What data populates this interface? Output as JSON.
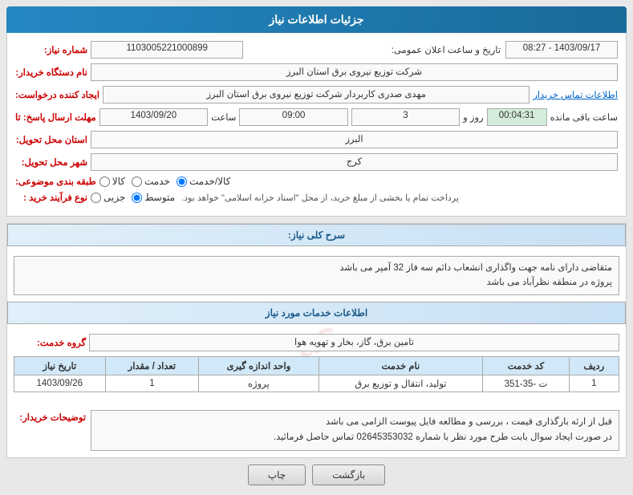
{
  "header": {
    "title": "جزئیات اطلاعات نیاز"
  },
  "form": {
    "need_number_label": "شماره نیاز:",
    "need_number_value": "1103005221000899",
    "buyer_org_label": "نام دستگاه خریدار:",
    "buyer_org_value": "شرکت توزیع نیروی برق استان البرز",
    "requester_label": "ایجاد کننده درخواست:",
    "requester_value": "مهدی صدری کاربردار شرکت توزیع نیروی برق استان البرز",
    "requester_contact_link": "اطلاعات تماس خریدار",
    "response_deadline_label": "مهلت ارسال پاسخ: تا",
    "response_deadline_date": "1403/09/20",
    "response_deadline_time": "09:00",
    "response_deadline_days": "3",
    "response_deadline_days_label": "روز و",
    "response_deadline_remaining": "00:04:31",
    "response_deadline_remaining_label": "ساعت باقی مانده",
    "delivery_province_label": "استان محل تحویل:",
    "delivery_province_value": "البرز",
    "delivery_city_label": "شهر محل تحویل:",
    "delivery_city_value": "کرج",
    "category_label": "طبقه بندی موضوعی:",
    "category_goods": "کالا",
    "category_service": "خدمت",
    "category_both": "کالا/خدمت",
    "order_type_label": "نوع فرآیند خرید :",
    "order_type_part": "جزیی",
    "order_type_mid": "متوسط",
    "order_type_full": "",
    "date_label": "تاریخ و ساعت اعلان عمومی:",
    "date_value": "1403/09/17 - 08:27"
  },
  "need_description": {
    "section_title": "سرح کلی نیاز:",
    "text_line1": "متقاضی دارای نامه جهت واگذاری انشعاب دائم سه فاز 32 آمپر می باشد",
    "text_line2": "پروژه در منطقه نظرآباد می باشد"
  },
  "service_info": {
    "section_title": "اطلاعات خدمات مورد نیاز",
    "service_group_label": "گروه خدمت:",
    "service_group_value": "تامین برق، گاز، بخار و تهویه هوا",
    "table_headers": [
      "ردیف",
      "کد خدمت",
      "نام خدمت",
      "واحد اندازه گیری",
      "تعداد / مقدار",
      "تاریخ نیاز"
    ],
    "table_rows": [
      {
        "row": "1",
        "code": "ت -35-351",
        "name": "تولید، انتقال و توزیع برق",
        "unit": "پروژه",
        "qty": "1",
        "date": "1403/09/26"
      }
    ]
  },
  "buyer_notes": {
    "label": "توضیحات خریدار:",
    "line1": "قبل از ارئه بارگذاری قیمت ، بررسی و مطالعه فایل پیوست الزامی می باشد",
    "line2": "در صورت ایجاد سوال بابت طرح مورد نظر با شماره 02645353032 تماس حاصل فرمائید."
  },
  "buttons": {
    "back_label": "بازگشت",
    "print_label": "چاپ"
  },
  "watermark": "as"
}
